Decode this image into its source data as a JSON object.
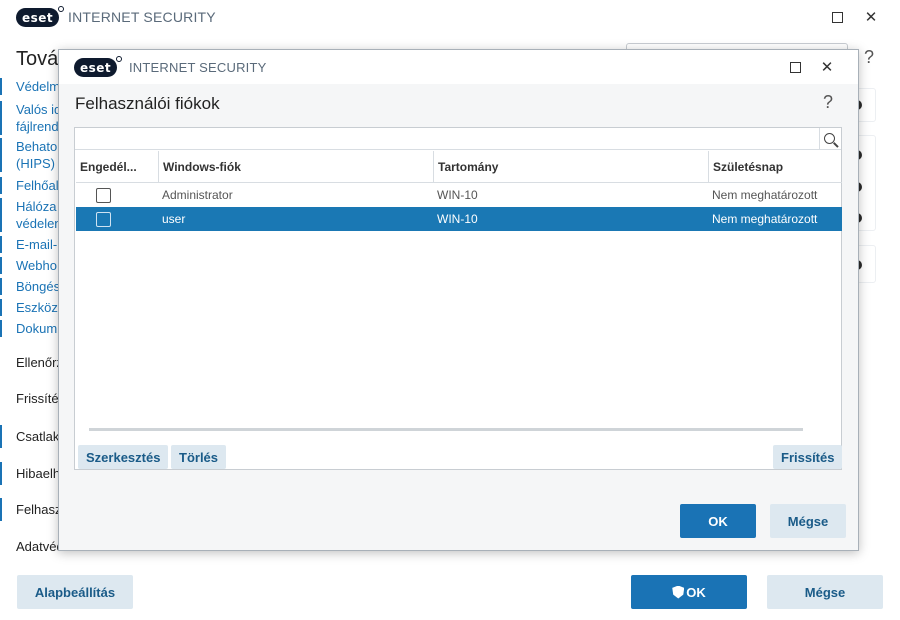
{
  "app": {
    "logo_text": "eset",
    "title": "INTERNET SECURITY",
    "maximize_icon": "square-icon",
    "close_icon": "close-icon"
  },
  "main": {
    "heading": "Tová",
    "help": "?",
    "sidebar": [
      "Védelm",
      "Valós id",
      "fájlrend",
      "Behato",
      "(HIPS)",
      "Felhőal",
      "Hálóza",
      "védelen",
      "E-mail-",
      "Webho",
      "Böngés",
      "Eszközt",
      "Dokum"
    ],
    "sections": [
      "Ellenőrz",
      "Frissíté",
      "Csatlak",
      "Hibaelh",
      "Felhasz",
      "Adatvédelmi beállítások"
    ],
    "buttons": {
      "default": "Alapbeállítás",
      "ok": "OK",
      "cancel": "Mégse"
    }
  },
  "dialog": {
    "title": "INTERNET SECURITY",
    "heading": "Felhasználói fiókok",
    "help": "?",
    "filter_placeholder": "",
    "table": {
      "columns": [
        "Engedél...",
        "Windows-fiók",
        "Tartomány",
        "Születésnap"
      ],
      "rows": [
        {
          "enabled": false,
          "account": "Administrator",
          "domain": "WIN-10",
          "birthday": "Nem meghatározott",
          "selected": false
        },
        {
          "enabled": false,
          "account": "user",
          "domain": "WIN-10",
          "birthday": "Nem meghatározott",
          "selected": true
        }
      ]
    },
    "panel_buttons": {
      "edit": "Szerkesztés",
      "delete": "Törlés",
      "refresh": "Frissítés"
    },
    "buttons": {
      "ok": "OK",
      "cancel": "Mégse"
    }
  },
  "colors": {
    "accent": "#1a73b5",
    "selected_row": "#1a78b4",
    "secondary_button": "#dde8f0"
  }
}
